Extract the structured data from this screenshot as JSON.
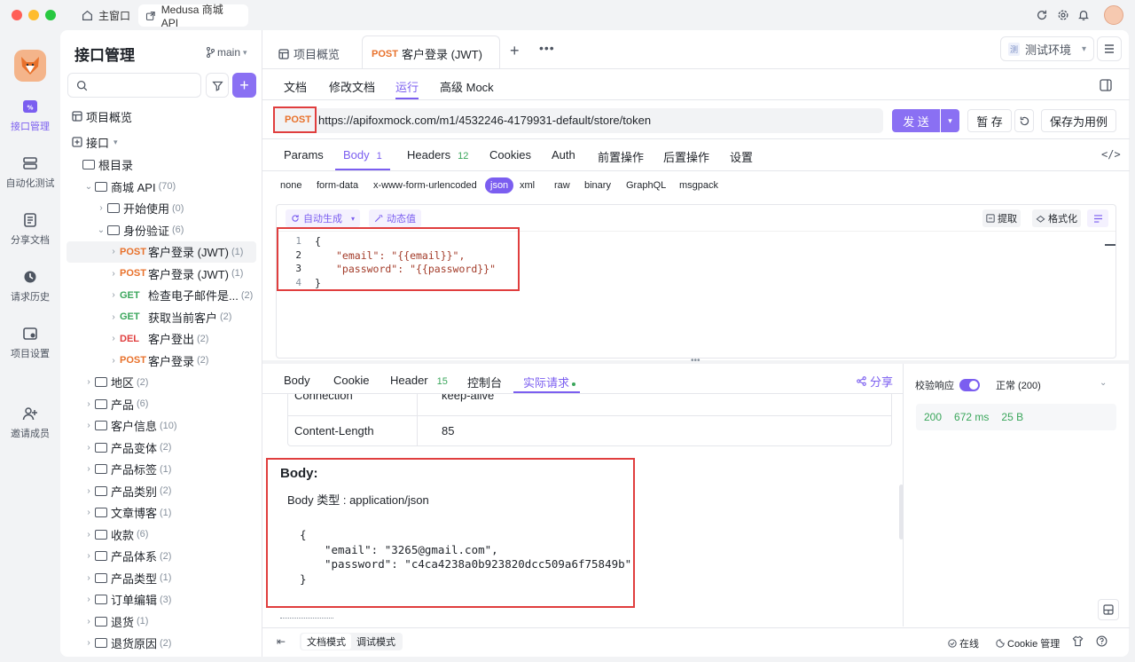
{
  "window": {
    "home_tab": "主窗口",
    "project_tab": "Medusa 商城 API"
  },
  "rail": {
    "items": [
      {
        "label": "接口管理"
      },
      {
        "label": "自动化测试"
      },
      {
        "label": "分享文档"
      },
      {
        "label": "请求历史"
      },
      {
        "label": "项目设置"
      },
      {
        "label": "邀请成员"
      }
    ]
  },
  "sidebar": {
    "title": "接口管理",
    "branch": "main",
    "overview": "项目概览",
    "api_root": "接口",
    "root_dir": "根目录",
    "tree": [
      {
        "type": "folder",
        "label": "商城 API",
        "count": "(70)",
        "level": 1,
        "open": true
      },
      {
        "type": "folder",
        "label": "开始使用",
        "count": "(0)",
        "level": 2
      },
      {
        "type": "folder",
        "label": "身份验证",
        "count": "(6)",
        "level": 2,
        "open": true
      },
      {
        "type": "api",
        "method": "POST",
        "label": "客户登录 (JWT)",
        "count": "(1)",
        "level": 3,
        "selected": true
      },
      {
        "type": "api",
        "method": "POST",
        "label": "客户登录 (JWT)",
        "count": "(1)",
        "level": 3
      },
      {
        "type": "api",
        "method": "GET",
        "label": "检查电子邮件是...",
        "count": "(2)",
        "level": 3
      },
      {
        "type": "api",
        "method": "GET",
        "label": "获取当前客户",
        "count": "(2)",
        "level": 3
      },
      {
        "type": "api",
        "method": "DEL",
        "label": "客户登出",
        "count": "(2)",
        "level": 3
      },
      {
        "type": "api",
        "method": "POST",
        "label": "客户登录",
        "count": "(2)",
        "level": 3
      },
      {
        "type": "folder",
        "label": "地区",
        "count": "(2)",
        "level": 1
      },
      {
        "type": "folder",
        "label": "产品",
        "count": "(6)",
        "level": 1
      },
      {
        "type": "folder",
        "label": "客户信息",
        "count": "(10)",
        "level": 1
      },
      {
        "type": "folder",
        "label": "产品变体",
        "count": "(2)",
        "level": 1
      },
      {
        "type": "folder",
        "label": "产品标签",
        "count": "(1)",
        "level": 1
      },
      {
        "type": "folder",
        "label": "产品类别",
        "count": "(2)",
        "level": 1
      },
      {
        "type": "folder",
        "label": "文章博客",
        "count": "(1)",
        "level": 1
      },
      {
        "type": "folder",
        "label": "收款",
        "count": "(6)",
        "level": 1
      },
      {
        "type": "folder",
        "label": "产品体系",
        "count": "(2)",
        "level": 1
      },
      {
        "type": "folder",
        "label": "产品类型",
        "count": "(1)",
        "level": 1
      },
      {
        "type": "folder",
        "label": "订单编辑",
        "count": "(3)",
        "level": 1
      },
      {
        "type": "folder",
        "label": "退货",
        "count": "(1)",
        "level": 1
      },
      {
        "type": "folder",
        "label": "退货原因",
        "count": "(2)",
        "level": 1
      }
    ]
  },
  "tabs": {
    "overview": "项目概览",
    "active_method": "POST",
    "active_label": "客户登录 (JWT)",
    "env": "测试环境",
    "env_badge": "测"
  },
  "subtabs": [
    "文档",
    "修改文档",
    "运行",
    "高级 Mock"
  ],
  "request": {
    "method": "POST",
    "url": "https://apifoxmock.com/m1/4532246-4179931-default/store/token",
    "send": "发 送",
    "save": "暂 存",
    "save_case": "保存为用例"
  },
  "req_tabs": [
    {
      "label": "Params",
      "badge": ""
    },
    {
      "label": "Body",
      "badge": "1"
    },
    {
      "label": "Headers",
      "badge": "12"
    },
    {
      "label": "Cookies",
      "badge": ""
    },
    {
      "label": "Auth",
      "badge": ""
    },
    {
      "label": "前置操作",
      "badge": ""
    },
    {
      "label": "后置操作",
      "badge": ""
    },
    {
      "label": "设置",
      "badge": ""
    }
  ],
  "body_types": [
    "none",
    "form-data",
    "x-www-form-urlencoded",
    "json",
    "xml",
    "raw",
    "binary",
    "GraphQL",
    "msgpack"
  ],
  "editor": {
    "auto_gen": "自动生成",
    "dynamic": "动态值",
    "extract": "提取",
    "format": "格式化",
    "lines": [
      "{",
      "\"email\": \"{{email}}\",",
      "\"password\": \"{{password}}\"",
      "}"
    ],
    "line_numbers": [
      "1",
      "2",
      "3",
      "4"
    ]
  },
  "resp_tabs": [
    {
      "label": "Body",
      "badge": ""
    },
    {
      "label": "Cookie",
      "badge": ""
    },
    {
      "label": "Header",
      "badge": "15"
    },
    {
      "label": "控制台",
      "badge": ""
    },
    {
      "label": "实际请求",
      "badge": ""
    }
  ],
  "share": "分享",
  "headers_table": [
    {
      "key": "Connection",
      "value": "keep-alive"
    },
    {
      "key": "Content-Length",
      "value": "85"
    }
  ],
  "actual_body": {
    "heading": "Body:",
    "type_line": "Body 类型 : application/json",
    "lines": [
      "{",
      "\"email\": \"3265@gmail.com\",",
      "\"password\": \"c4ca4238a0b923820dcc509a6f75849b\"",
      "}"
    ]
  },
  "validate": {
    "label": "校验响应",
    "status": "正常 (200)",
    "code": "200",
    "time": "672 ms",
    "size": "25 B"
  },
  "footer": {
    "doc_mode": "文档模式",
    "debug_mode": "调试模式",
    "online": "在线",
    "cookie_mgr": "Cookie 管理"
  },
  "colors": {
    "accent": "#7b5ef0",
    "post": "#e8712b",
    "get": "#3aa65b",
    "del": "#e03e3e"
  }
}
